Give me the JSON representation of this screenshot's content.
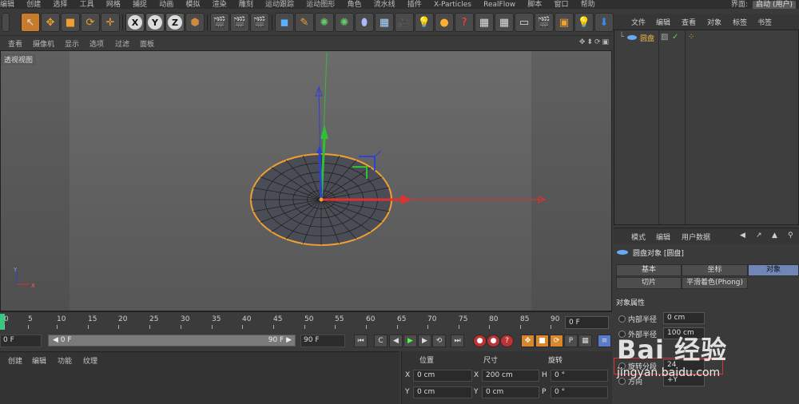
{
  "menubar": {
    "items": [
      "编辑",
      "创建",
      "选择",
      "工具",
      "网格",
      "捕捉",
      "动画",
      "模拟",
      "渲染",
      "雕刻",
      "运动跟踪",
      "运动图形",
      "角色",
      "流水线",
      "插件",
      "X-Particles",
      "RealFlow",
      "脚本",
      "窗口",
      "帮助"
    ],
    "layout_label": "界面:",
    "layout_value": "启动 (用户)"
  },
  "toolbar": {
    "axis_x": "X",
    "axis_y": "Y",
    "axis_z": "Z"
  },
  "viewport": {
    "menu": [
      "查看",
      "摄像机",
      "显示",
      "选项",
      "过滤",
      "面板"
    ],
    "label": "透视视图",
    "nav": "✥⬍⟳▣"
  },
  "timeline": {
    "ticks": [
      "0",
      "5",
      "10",
      "15",
      "20",
      "25",
      "30",
      "35",
      "40",
      "45",
      "50",
      "55",
      "60",
      "65",
      "70",
      "75",
      "80",
      "85",
      "90"
    ],
    "end_frame": "0 F"
  },
  "playback": {
    "start_field": "0 F",
    "range_start": "◀ 0 F",
    "range_end": "90 F ▶",
    "end_field": "90 F"
  },
  "material_menu": [
    "创建",
    "编辑",
    "功能",
    "纹理"
  ],
  "coords": {
    "headers": [
      "位置",
      "尺寸",
      "旋转"
    ],
    "rows": [
      {
        "pos_label": "X",
        "pos": "0 cm",
        "size_label": "X",
        "size": "200 cm",
        "rot_label": "H",
        "rot": "0 °"
      },
      {
        "pos_label": "Y",
        "pos": "0 cm",
        "size_label": "Y",
        "size": "0 cm",
        "rot_label": "P",
        "rot": "0 °"
      }
    ]
  },
  "object_manager": {
    "menu": [
      "文件",
      "编辑",
      "查看",
      "对象",
      "标签",
      "书签"
    ],
    "object_name": "圆盘"
  },
  "attributes": {
    "menu": [
      "模式",
      "编辑",
      "用户数据"
    ],
    "title": "圆盘对象 [圆盘]",
    "tabs": [
      "基本",
      "坐标",
      "对象",
      "切片",
      "平滑着色(Phong)"
    ],
    "section": "对象属性",
    "props": [
      {
        "label": "内部半径",
        "value": "0 cm"
      },
      {
        "label": "外部半径",
        "value": "100 cm"
      },
      {
        "label": "旋转分段",
        "value": "24"
      },
      {
        "label": "方向",
        "value": "+Y"
      }
    ]
  },
  "watermark": {
    "logo": "Bai 经验",
    "url": "jingyan.baidu.com"
  },
  "colors": {
    "accent_orange": "#f0a030",
    "axis_x": "#e03030",
    "axis_y": "#30c030",
    "axis_z": "#3040d0",
    "tab_active": "#6f86b6"
  }
}
